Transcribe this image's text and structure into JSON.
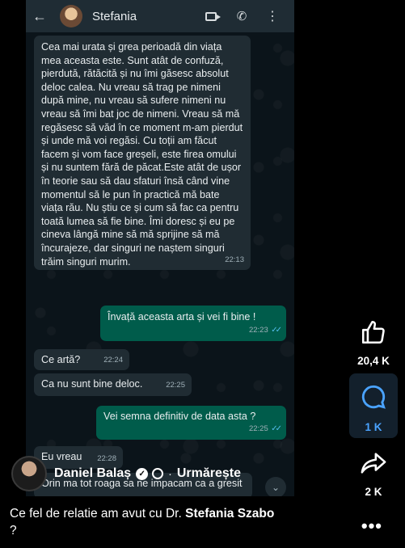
{
  "chat": {
    "contact_name": "Stefania",
    "icons": {
      "back": "arrow-left-icon",
      "video": "video-call-icon",
      "call": "phone-icon",
      "menu": "more-vertical-icon"
    },
    "messages": [
      {
        "dir": "in",
        "text": "Cea mai urata și grea perioadă din viața mea aceasta este. Sunt atât de confuză, pierdută, rătăcită și nu îmi găsesc absolut deloc calea. Nu vreau să trag pe nimeni după mine, nu vreau să sufere nimeni nu vreau să îmi bat joc de nimeni. Vreau să mă regăsesc să văd în ce moment m-am pierdut și unde mă voi regăsi. Cu toții am făcut facem și vom face greșeli, este firea omului și nu suntem fără de păcat.Este atât de ușor în teorie sau să dau sfaturi însă când vine momentul să le pun în practică mă bate viața rău. Nu știu ce și cum să fac ca pentru toată lumea să fie bine. Îmi doresc și eu pe cineva lângă mine să mă sprijine să mă încurajeze, dar singuri ne naștem singuri trăim singuri murim.",
        "time": "22:13"
      },
      {
        "dir": "out",
        "text": "Învață aceasta arta și vei fi bine !",
        "time": "22:23"
      },
      {
        "dir": "in",
        "text": "Ce artă?",
        "time": "22:24"
      },
      {
        "dir": "in",
        "text": "Ca nu sunt bine deloc.",
        "time": "22:25"
      },
      {
        "dir": "out",
        "text": "Vei semna definitiv de data asta ?",
        "time": "22:25"
      },
      {
        "dir": "in",
        "text": "Eu vreau",
        "time": "22:28"
      },
      {
        "dir": "in",
        "text": "Orin ma tot roaga sa ne impacam ca a gresit"
      }
    ]
  },
  "reel": {
    "author_name": "Daniel Balaș",
    "follow_label": "Urmărește",
    "separator": "·",
    "caption_prefix": "Ce fel de relatie am avut cu Dr. ",
    "caption_bold": "Stefania Szabo",
    "caption_suffix": "?",
    "more_label": "•••",
    "likes": "20,4 K",
    "comments": "1 K",
    "shares": "2 K",
    "icons": {
      "like": "thumbs-up-icon",
      "comment": "comment-icon",
      "share": "share-icon",
      "verified": "verified-badge-icon",
      "globe": "globe-icon"
    },
    "colors": {
      "comment_active": "#4aa3ff",
      "outgoing_bubble": "#005c4b",
      "incoming_bubble": "#202c33"
    }
  }
}
